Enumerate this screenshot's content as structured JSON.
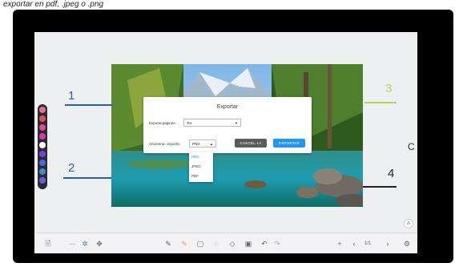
{
  "caption": "exportar en pdf, .jpeg o .png",
  "annotations": {
    "n1": "1",
    "n2": "2",
    "n3": "3",
    "n4": "4"
  },
  "colors": {
    "annotation_blue": "#2c5fa8",
    "annotation_green": "#b8d35a",
    "accent_blue": "#2196f3",
    "cancel_gray": "#5b5b5b"
  },
  "dialog": {
    "title": "Exportar",
    "pages_label": "Exporta pàgines:",
    "pages_value": "Tot",
    "save_label": "Anomena i exporta:",
    "save_value": "PNG",
    "cancel_label": "CANCEL·LA",
    "export_label": "EXPORTAR"
  },
  "dropdown_options": [
    "PNG",
    "JPEG",
    "PDF"
  ],
  "palette": {
    "colors": [
      "#f06a8a",
      "#e64a5a",
      "#e54a8b",
      "#d93aa4",
      "#ffffff",
      "#7b3fd8",
      "#4d6bd6",
      "#3f8ad8",
      "#6a5cd6"
    ]
  },
  "toolbar": {
    "icons": [
      "save-file-icon",
      "more-dots-icon",
      "select-cursor-icon",
      "move-icon",
      "pen-icon",
      "highlighter-icon",
      "shape-icon",
      "lasso-icon",
      "eraser-icon",
      "insert-image-icon",
      "undo-icon",
      "redo-icon",
      "add-page-icon",
      "prev-page-icon",
      "next-page-icon",
      "settings-icon"
    ],
    "page_indicator": "1/1"
  },
  "side_letter": "C"
}
